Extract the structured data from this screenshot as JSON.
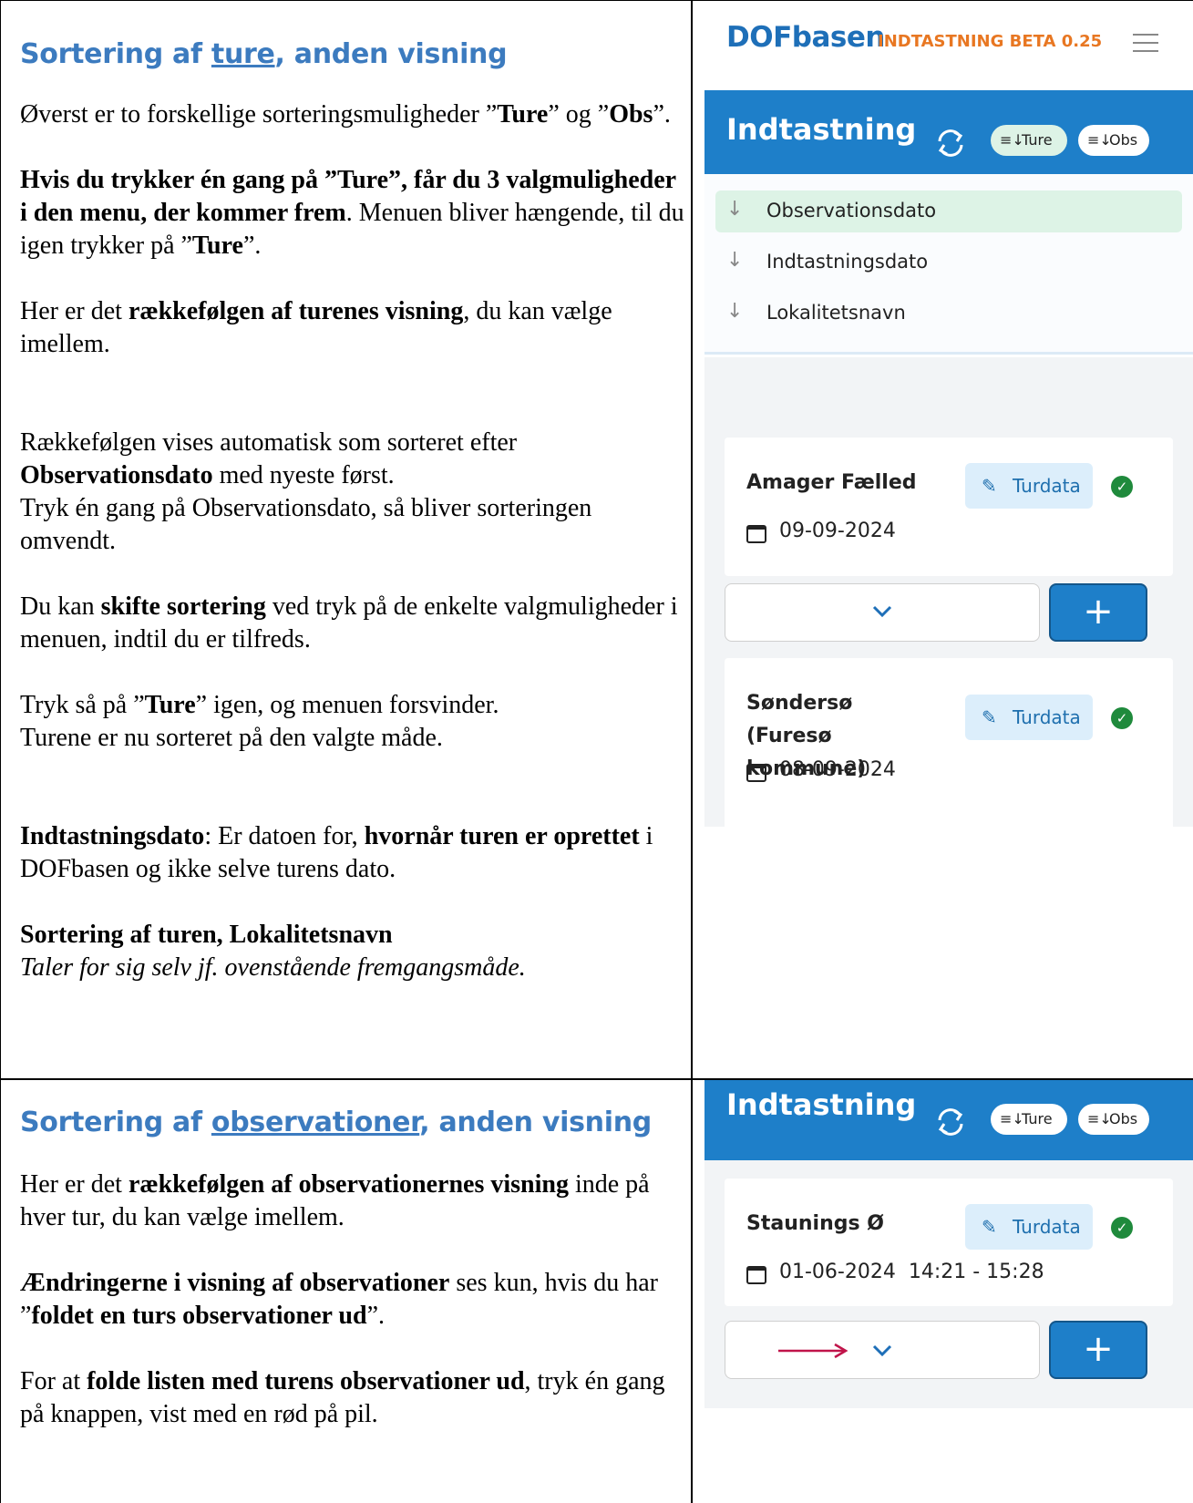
{
  "section1": {
    "heading_pre": "Sortering af ",
    "heading_link": "ture",
    "heading_post": ", anden visning",
    "p1": {
      "a": "Øverst er to forskellige sorteringsmuligheder ”",
      "b": "Ture",
      "c": "” og ”",
      "d": "Obs",
      "e": "”."
    },
    "p2": {
      "a": "Hvis du trykker én gang på ”Ture”, får du 3 valgmuligheder i den menu, der kommer frem",
      "b": ". Menuen bliver hængende, til du igen trykker på ”",
      "c": "Ture",
      "d": "”."
    },
    "p3": {
      "a": "Her er det ",
      "b": "rækkefølgen af turenes visning",
      "c": ", du kan vælge imellem."
    },
    "p4": {
      "a": "Rækkefølgen vises automatisk som sorteret efter ",
      "b": "Observationsdato",
      "c": " med nyeste først.",
      "d": "Tryk én gang på Observationsdato, så bliver sorteringen omvendt."
    },
    "p5": {
      "a": "Du kan ",
      "b": "skifte sortering",
      "c": " ved tryk på de enkelte valgmuligheder i menuen, indtil du er tilfreds."
    },
    "p6": {
      "a": "Tryk så på ”",
      "b": "Ture",
      "c": "” igen, og menuen forsvinder.",
      "d": "Turene er nu sorteret på den valgte måde."
    },
    "p7": {
      "a": "Indtastningsdato",
      "b": ": Er datoen for, ",
      "c": "hvornår turen er oprettet",
      "d": " i DOFbasen og ikke selve turens dato."
    },
    "p8": {
      "a": "Sortering af turen, Lokalitetsnavn",
      "b": "Taler for sig selv jf. ovenstående fremgangsmåde."
    }
  },
  "section2": {
    "heading_pre": "Sortering af ",
    "heading_link": "observationer",
    "heading_post": ", anden visning",
    "p1": {
      "a": "Her er det ",
      "b": "rækkefølgen af observationernes visning",
      "c": " inde på hver tur, du kan vælge imellem."
    },
    "p2": {
      "a": "Ændringerne i visning af observationer",
      "b": " ses kun, hvis du har ”",
      "c": "foldet en turs observationer ud",
      "d": "”."
    },
    "p3": {
      "a": "For at ",
      "b": "folde listen med turens observationer ud",
      "c": ", tryk én gang på knappen, vist med en rød på pil."
    }
  },
  "app": {
    "logo": "DOFbasen",
    "subtitle": "INDTASTNING BETA 0.25",
    "title": "Indtastning",
    "chip_ture": "Ture",
    "chip_obs": "Obs",
    "sort_options": [
      "Observationsdato",
      "Indtastningsdato",
      "Lokalitetsnavn"
    ],
    "turdata_label": "Turdata",
    "cards": [
      {
        "title": "Amager Fælled",
        "date": "09-09-2024"
      },
      {
        "title": "Søndersø (Furesø kommune)",
        "date": "08-09-2024"
      }
    ],
    "card3": {
      "title": "Staunings Ø",
      "date": "01-06-2024  14:21 - 15:28"
    },
    "colors": {
      "primary": "#1e7fc9",
      "selected_row": "#ddf3e6",
      "check": "#1f8a3c",
      "heading_blue": "#3c7bbf",
      "arrow_red": "#c0144a"
    }
  }
}
